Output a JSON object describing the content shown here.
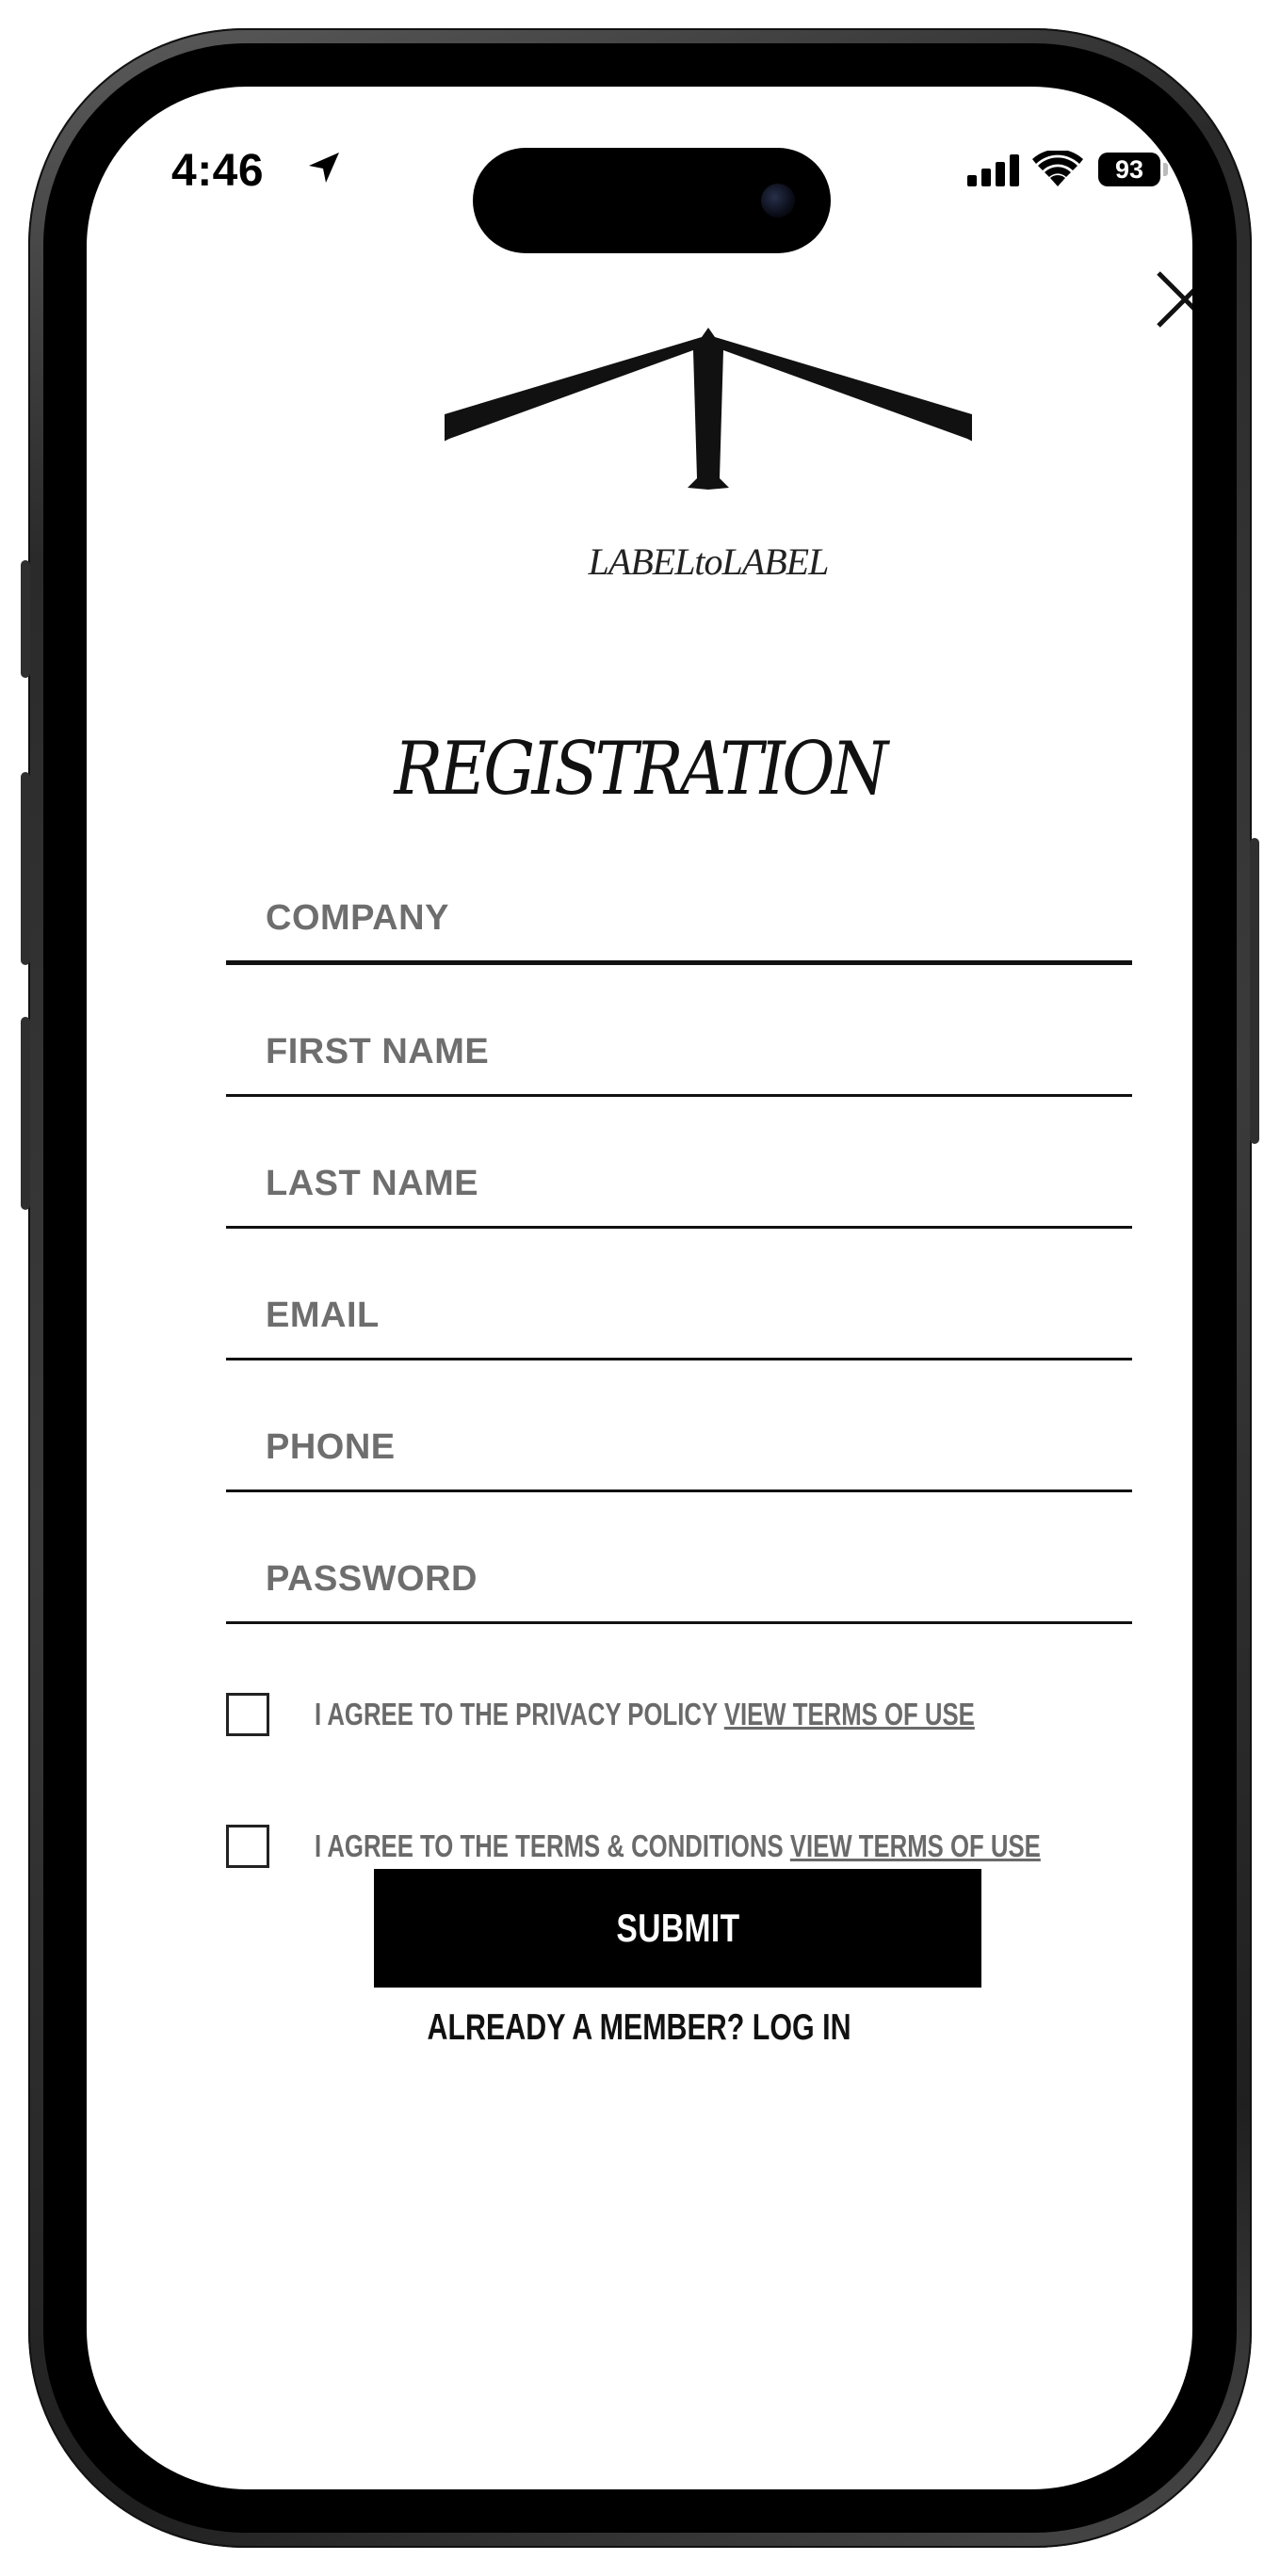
{
  "status_bar": {
    "time": "4:46",
    "battery": "93"
  },
  "brand": {
    "logo_text": "LABELtoLABEL"
  },
  "form": {
    "title": "REGISTRATION",
    "fields": {
      "company": "COMPANY",
      "first_name": "FIRST NAME",
      "last_name": "LAST NAME",
      "email": "EMAIL",
      "phone": "PHONE",
      "password": "PASSWORD"
    },
    "privacy": {
      "label": "I AGREE TO THE PRIVACY POLICY ",
      "link": "VIEW TERMS OF USE",
      "checked": false
    },
    "terms": {
      "label": "I AGREE TO THE TERMS & CONDITIONS ",
      "link": "VIEW TERMS OF USE",
      "checked": false
    },
    "submit_label": "SUBMIT",
    "login_text": "ALREADY A MEMBER? LOG IN"
  },
  "icons": {
    "close": "close-icon",
    "location": "location-arrow-icon",
    "signal": "cellular-signal-icon",
    "wifi": "wifi-icon",
    "battery": "battery-icon"
  }
}
